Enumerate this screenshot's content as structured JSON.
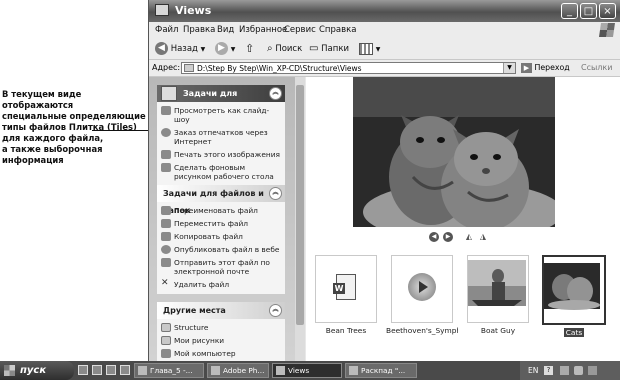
{
  "callout": "В текущем виде отображаются\nспециальные определяющие\nтипы файлов Плитка (Tiles)\nдля каждого файла,\nа также выборочная\nинформация",
  "window": {
    "title": "Views"
  },
  "menu": [
    "Файл",
    "Правка",
    "Вид",
    "Избранное",
    "Сервис",
    "Справка"
  ],
  "toolbar": {
    "back": "Назад",
    "search": "Поиск",
    "folders": "Папки"
  },
  "address": {
    "label": "Адрес:",
    "path": "D:\\Step By Step\\Win_XP-CD\\Structure\\Views",
    "go": "Переход",
    "links": "Ссылки"
  },
  "tasks_image": {
    "title": "Задачи для изображен",
    "items": [
      "Просмотреть как слайд-шоу",
      "Заказ отпечатков через Интернет",
      "Печать этого изображения",
      "Сделать фоновым рисунком рабочего стола"
    ]
  },
  "tasks_files": {
    "title": "Задачи для файлов и папок",
    "items": [
      "Переименовать файл",
      "Переместить файл",
      "Копировать файл",
      "Опубликовать файл в вебе",
      "Отправить этот файл по электронной почте",
      "Удалить файл"
    ]
  },
  "other_places": {
    "title": "Другие места",
    "items": [
      "Structure",
      "Мои рисунки",
      "Мой компьютер"
    ]
  },
  "files": [
    {
      "name": "Bean Trees",
      "kind": "word-doc"
    },
    {
      "name": "Beethoven's_Symphon...",
      "kind": "media"
    },
    {
      "name": "Boat Guy",
      "kind": "photo"
    },
    {
      "name": "Cats",
      "kind": "photo",
      "selected": true
    }
  ],
  "taskbar": {
    "start": "пуск",
    "tasks": [
      "Глава_5 -...",
      "Adobe Ph...",
      "Views",
      "Раскпад \"..."
    ],
    "tray": {
      "lang": "EN",
      "help": "?"
    }
  }
}
